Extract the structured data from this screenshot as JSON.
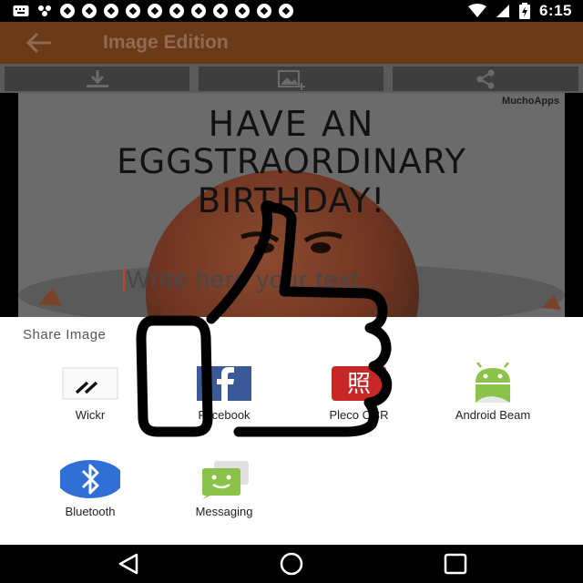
{
  "status_bar": {
    "time": "6:15"
  },
  "app_bar": {
    "title": "Image Edition"
  },
  "toolbar": {
    "buttons": [
      "download-icon",
      "add-image-icon",
      "share-icon"
    ]
  },
  "canvas": {
    "watermark": "MuchoApps",
    "headline_line1": "HAVE AN",
    "headline_line2": "EGGSTRAORDINARY BIRTHDAY!",
    "placeholder": "Write here your text..."
  },
  "share_sheet": {
    "title": "Share Image",
    "apps": [
      {
        "label": "Wickr",
        "icon": "wickr-icon"
      },
      {
        "label": "Facebook",
        "icon": "facebook-icon"
      },
      {
        "label": "Pleco OCR",
        "icon": "pleco-ocr-icon"
      },
      {
        "label": "Android Beam",
        "icon": "android-beam-icon"
      },
      {
        "label": "Bluetooth",
        "icon": "bluetooth-icon"
      },
      {
        "label": "Messaging",
        "icon": "messaging-icon"
      }
    ]
  },
  "nav_bar": {
    "buttons": [
      "back-icon",
      "home-icon",
      "recents-icon"
    ]
  },
  "colors": {
    "app_bar": "#6b3a16",
    "facebook": "#3b5998",
    "bluetooth": "#2f6fd6",
    "android_green": "#8bc34a",
    "pleco_red": "#c62828"
  }
}
